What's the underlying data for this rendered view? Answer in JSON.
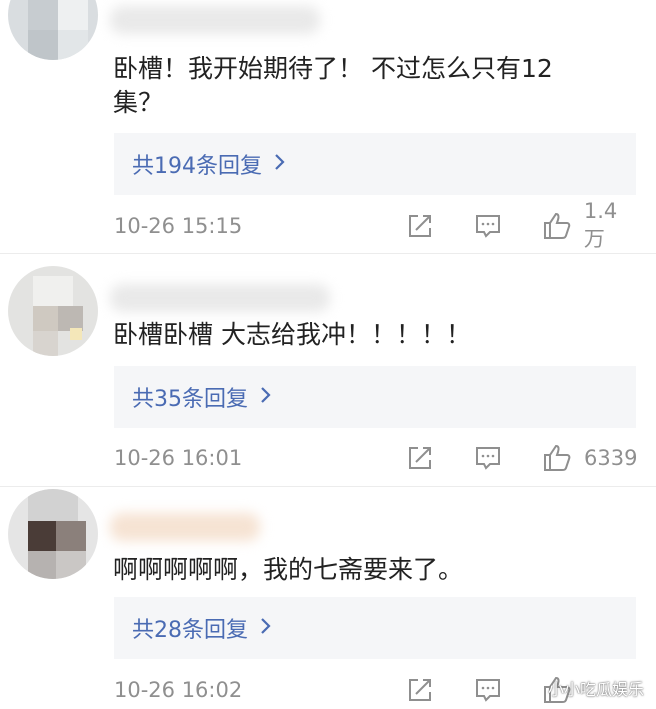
{
  "comments": [
    {
      "text": "卧槽！我开始期待了！ 不过怎么只有12集？",
      "text_line1": "卧槽！我开始期待了！ 不过怎么只有12",
      "text_line2": "集？",
      "replies_label": "共194条回复",
      "time": "10-26 15:15",
      "likes": "1.4万"
    },
    {
      "text": "卧槽卧槽 大志给我冲！！！！！",
      "replies_label": "共35条回复",
      "time": "10-26 16:01",
      "likes": "6339"
    },
    {
      "text": "啊啊啊啊啊，我的七斋要来了。",
      "replies_label": "共28条回复",
      "time": "10-26 16:02",
      "likes": ""
    }
  ],
  "watermark": "小小吃瓜娱乐",
  "icons": {
    "share": "share-icon",
    "comment": "comment-icon",
    "like": "thumbs-up-icon",
    "chevron": "chevron-right-icon"
  },
  "colors": {
    "reply_link": "#4a6bb3",
    "meta_text": "#8f8f8f",
    "reply_bg": "#f5f6f8"
  }
}
